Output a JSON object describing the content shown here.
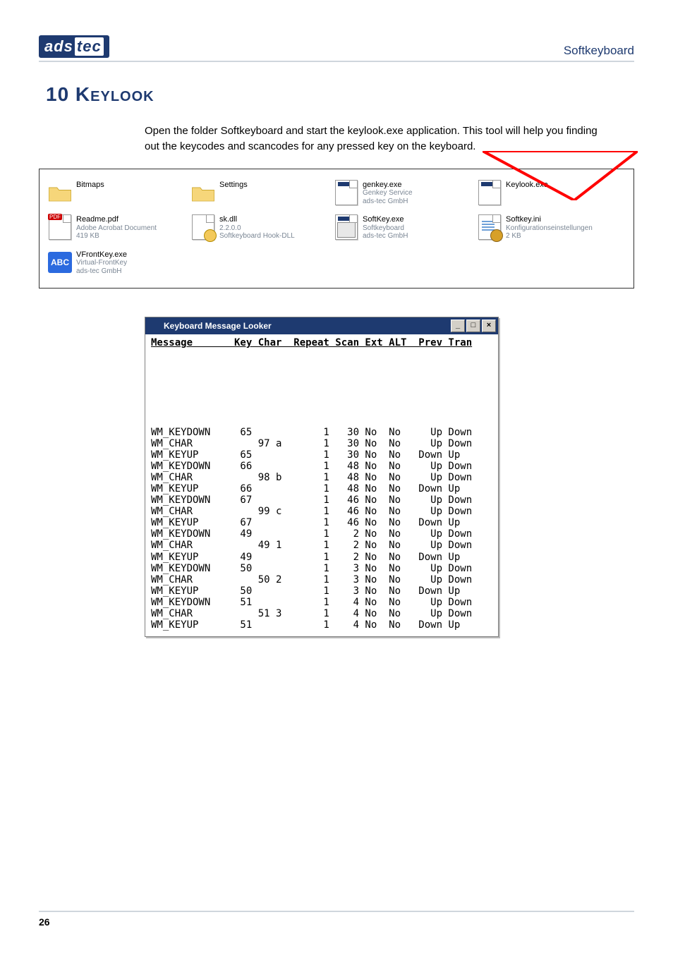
{
  "header": {
    "logo_left": "ads",
    "logo_right": "tec",
    "doc_title": "Softkeyboard"
  },
  "chapter_title": "10 Keylook",
  "body_paragraph": "Open the folder Softkeyboard and start the keylook.exe application. This tool will help you finding out the keycodes and scancodes for any pressed key on the keyboard.",
  "explorer_items": [
    {
      "name": "Bitmaps",
      "meta1": "",
      "meta2": "",
      "icon": "folder"
    },
    {
      "name": "Settings",
      "meta1": "",
      "meta2": "",
      "icon": "folder"
    },
    {
      "name": "genkey.exe",
      "meta1": "Genkey Service",
      "meta2": "ads-tec GmbH",
      "icon": "exe"
    },
    {
      "name": "Keylook.exe",
      "meta1": "",
      "meta2": "",
      "icon": "exe",
      "highlight": true
    },
    {
      "name": "Readme.pdf",
      "meta1": "Adobe Acrobat Document",
      "meta2": "419 KB",
      "icon": "pdf"
    },
    {
      "name": "sk.dll",
      "meta1": "2.2.0.0",
      "meta2": "Softkeyboard Hook-DLL",
      "icon": "dll"
    },
    {
      "name": "SoftKey.exe",
      "meta1": "Softkeyboard",
      "meta2": "ads-tec GmbH",
      "icon": "kbexe"
    },
    {
      "name": "Softkey.ini",
      "meta1": "Konfigurationseinstellungen",
      "meta2": "2 KB",
      "icon": "ini"
    },
    {
      "name": "VFrontKey.exe",
      "meta1": "Virtual-FrontKey",
      "meta2": "ads-tec GmbH",
      "icon": "abc"
    }
  ],
  "kml": {
    "window_title": "Keyboard Message Looker",
    "columns": [
      "Message",
      "Key",
      "Char",
      "Repeat",
      "Scan",
      "Ext",
      "ALT",
      "Prev",
      "Tran"
    ],
    "rows": [
      {
        "msg": "WM_KEYDOWN",
        "key": "65",
        "ch": "",
        "repeat": "1",
        "scan": "30",
        "ext": "No",
        "alt": "No",
        "prev": "Up",
        "tran": "Down"
      },
      {
        "msg": "WM_CHAR",
        "key": "",
        "ch": "97 a",
        "repeat": "1",
        "scan": "30",
        "ext": "No",
        "alt": "No",
        "prev": "Up",
        "tran": "Down"
      },
      {
        "msg": "WM_KEYUP",
        "key": "65",
        "ch": "",
        "repeat": "1",
        "scan": "30",
        "ext": "No",
        "alt": "No",
        "prev": "Down",
        "tran": "Up"
      },
      {
        "msg": "WM_KEYDOWN",
        "key": "66",
        "ch": "",
        "repeat": "1",
        "scan": "48",
        "ext": "No",
        "alt": "No",
        "prev": "Up",
        "tran": "Down"
      },
      {
        "msg": "WM_CHAR",
        "key": "",
        "ch": "98 b",
        "repeat": "1",
        "scan": "48",
        "ext": "No",
        "alt": "No",
        "prev": "Up",
        "tran": "Down"
      },
      {
        "msg": "WM_KEYUP",
        "key": "66",
        "ch": "",
        "repeat": "1",
        "scan": "48",
        "ext": "No",
        "alt": "No",
        "prev": "Down",
        "tran": "Up"
      },
      {
        "msg": "WM_KEYDOWN",
        "key": "67",
        "ch": "",
        "repeat": "1",
        "scan": "46",
        "ext": "No",
        "alt": "No",
        "prev": "Up",
        "tran": "Down"
      },
      {
        "msg": "WM_CHAR",
        "key": "",
        "ch": "99 c",
        "repeat": "1",
        "scan": "46",
        "ext": "No",
        "alt": "No",
        "prev": "Up",
        "tran": "Down"
      },
      {
        "msg": "WM_KEYUP",
        "key": "67",
        "ch": "",
        "repeat": "1",
        "scan": "46",
        "ext": "No",
        "alt": "No",
        "prev": "Down",
        "tran": "Up"
      },
      {
        "msg": "WM_KEYDOWN",
        "key": "49",
        "ch": "",
        "repeat": "1",
        "scan": "2",
        "ext": "No",
        "alt": "No",
        "prev": "Up",
        "tran": "Down"
      },
      {
        "msg": "WM_CHAR",
        "key": "",
        "ch": "49 1",
        "repeat": "1",
        "scan": "2",
        "ext": "No",
        "alt": "No",
        "prev": "Up",
        "tran": "Down"
      },
      {
        "msg": "WM_KEYUP",
        "key": "49",
        "ch": "",
        "repeat": "1",
        "scan": "2",
        "ext": "No",
        "alt": "No",
        "prev": "Down",
        "tran": "Up"
      },
      {
        "msg": "WM_KEYDOWN",
        "key": "50",
        "ch": "",
        "repeat": "1",
        "scan": "3",
        "ext": "No",
        "alt": "No",
        "prev": "Up",
        "tran": "Down"
      },
      {
        "msg": "WM_CHAR",
        "key": "",
        "ch": "50 2",
        "repeat": "1",
        "scan": "3",
        "ext": "No",
        "alt": "No",
        "prev": "Up",
        "tran": "Down"
      },
      {
        "msg": "WM_KEYUP",
        "key": "50",
        "ch": "",
        "repeat": "1",
        "scan": "3",
        "ext": "No",
        "alt": "No",
        "prev": "Down",
        "tran": "Up"
      },
      {
        "msg": "WM_KEYDOWN",
        "key": "51",
        "ch": "",
        "repeat": "1",
        "scan": "4",
        "ext": "No",
        "alt": "No",
        "prev": "Up",
        "tran": "Down"
      },
      {
        "msg": "WM_CHAR",
        "key": "",
        "ch": "51 3",
        "repeat": "1",
        "scan": "4",
        "ext": "No",
        "alt": "No",
        "prev": "Up",
        "tran": "Down"
      },
      {
        "msg": "WM_KEYUP",
        "key": "51",
        "ch": "",
        "repeat": "1",
        "scan": "4",
        "ext": "No",
        "alt": "No",
        "prev": "Down",
        "tran": "Up"
      }
    ]
  },
  "footer": {
    "page_number": "26"
  },
  "win_buttons": {
    "min": "_",
    "max": "□",
    "close": "×"
  }
}
